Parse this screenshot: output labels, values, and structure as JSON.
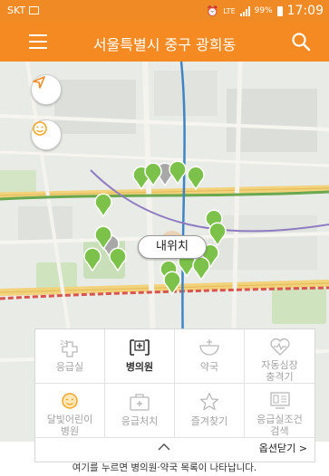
{
  "status_bar": {
    "carrier": "SKT",
    "network": "LTE",
    "battery": "99%",
    "time": "17:09"
  },
  "app_bar": {
    "title": "서울특별시 중구 광희동"
  },
  "map": {
    "my_location_label": "내위치"
  },
  "options": {
    "items": [
      {
        "label": "응급실",
        "icon": "er-24h-icon",
        "active": false
      },
      {
        "label": "병의원",
        "icon": "hospital-icon",
        "active": true
      },
      {
        "label": "약국",
        "icon": "pharmacy-icon",
        "active": false
      },
      {
        "label": "자동심장\n충격기",
        "icon": "aed-icon",
        "active": false
      },
      {
        "label": "달빛어린이\n병원",
        "icon": "moon-child-icon",
        "active": false
      },
      {
        "label": "응급처치",
        "icon": "first-aid-kit-icon",
        "active": false
      },
      {
        "label": "즐겨찾기",
        "icon": "star-icon",
        "active": false
      },
      {
        "label": "응급실조건\n검색",
        "icon": "er-condition-search-icon",
        "active": false
      }
    ],
    "close_label": "옵션닫기 >"
  },
  "footer": {
    "hint": "여기를 누르면 병의원·약국 목록이 나타납니다."
  },
  "colors": {
    "brand": "#f58a22",
    "marker_green": "#7cc24a",
    "marker_gray": "#a8a8a8",
    "moon_icon": "#f5a623"
  }
}
